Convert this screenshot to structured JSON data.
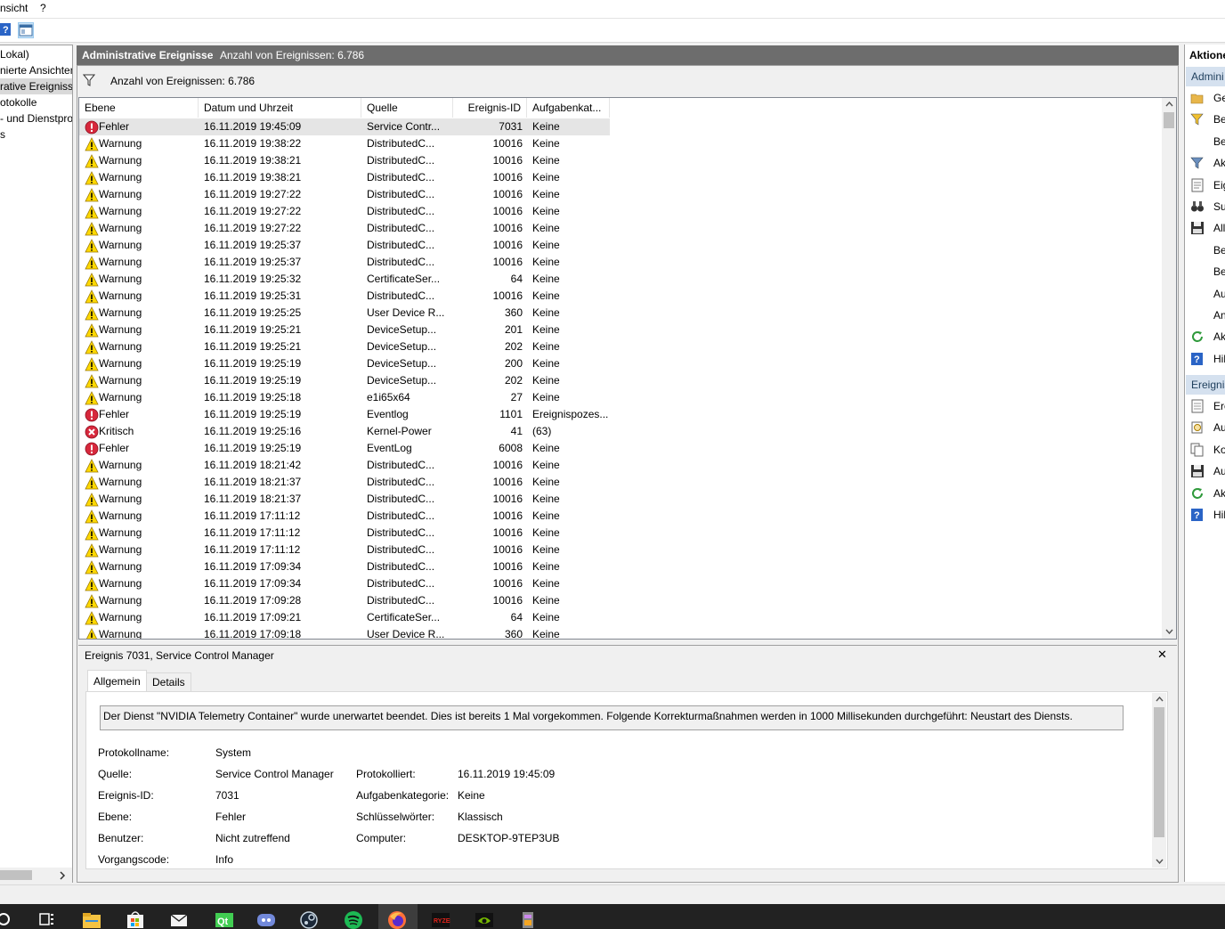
{
  "menu": {
    "items": [
      "nsicht",
      "?"
    ]
  },
  "tree": {
    "items": [
      {
        "label": "Lokal)"
      },
      {
        "label": "nierte Ansichten"
      },
      {
        "label": "rative Ereignisse",
        "selected": true
      },
      {
        "label": "otokolle"
      },
      {
        "label": "- und Dienstprot"
      },
      {
        "label": "s"
      }
    ]
  },
  "header": {
    "title": "Administrative Ereignisse",
    "count": "Anzahl von Ereignissen: 6.786"
  },
  "filter": {
    "label": "Anzahl von Ereignissen: 6.786"
  },
  "grid": {
    "columns": [
      "Ebene",
      "Datum und Uhrzeit",
      "Quelle",
      "Ereignis-ID",
      "Aufgabenkat..."
    ],
    "rows": [
      {
        "level": "Fehler",
        "type": "error",
        "dt": "16.11.2019 19:45:09",
        "src": "Service Contr...",
        "id": "7031",
        "task": "Keine",
        "selected": true
      },
      {
        "level": "Warnung",
        "type": "warn",
        "dt": "16.11.2019 19:38:22",
        "src": "DistributedC...",
        "id": "10016",
        "task": "Keine"
      },
      {
        "level": "Warnung",
        "type": "warn",
        "dt": "16.11.2019 19:38:21",
        "src": "DistributedC...",
        "id": "10016",
        "task": "Keine"
      },
      {
        "level": "Warnung",
        "type": "warn",
        "dt": "16.11.2019 19:38:21",
        "src": "DistributedC...",
        "id": "10016",
        "task": "Keine"
      },
      {
        "level": "Warnung",
        "type": "warn",
        "dt": "16.11.2019 19:27:22",
        "src": "DistributedC...",
        "id": "10016",
        "task": "Keine"
      },
      {
        "level": "Warnung",
        "type": "warn",
        "dt": "16.11.2019 19:27:22",
        "src": "DistributedC...",
        "id": "10016",
        "task": "Keine"
      },
      {
        "level": "Warnung",
        "type": "warn",
        "dt": "16.11.2019 19:27:22",
        "src": "DistributedC...",
        "id": "10016",
        "task": "Keine"
      },
      {
        "level": "Warnung",
        "type": "warn",
        "dt": "16.11.2019 19:25:37",
        "src": "DistributedC...",
        "id": "10016",
        "task": "Keine"
      },
      {
        "level": "Warnung",
        "type": "warn",
        "dt": "16.11.2019 19:25:37",
        "src": "DistributedC...",
        "id": "10016",
        "task": "Keine"
      },
      {
        "level": "Warnung",
        "type": "warn",
        "dt": "16.11.2019 19:25:32",
        "src": "CertificateSer...",
        "id": "64",
        "task": "Keine"
      },
      {
        "level": "Warnung",
        "type": "warn",
        "dt": "16.11.2019 19:25:31",
        "src": "DistributedC...",
        "id": "10016",
        "task": "Keine"
      },
      {
        "level": "Warnung",
        "type": "warn",
        "dt": "16.11.2019 19:25:25",
        "src": "User Device R...",
        "id": "360",
        "task": "Keine"
      },
      {
        "level": "Warnung",
        "type": "warn",
        "dt": "16.11.2019 19:25:21",
        "src": "DeviceSetup...",
        "id": "201",
        "task": "Keine"
      },
      {
        "level": "Warnung",
        "type": "warn",
        "dt": "16.11.2019 19:25:21",
        "src": "DeviceSetup...",
        "id": "202",
        "task": "Keine"
      },
      {
        "level": "Warnung",
        "type": "warn",
        "dt": "16.11.2019 19:25:19",
        "src": "DeviceSetup...",
        "id": "200",
        "task": "Keine"
      },
      {
        "level": "Warnung",
        "type": "warn",
        "dt": "16.11.2019 19:25:19",
        "src": "DeviceSetup...",
        "id": "202",
        "task": "Keine"
      },
      {
        "level": "Warnung",
        "type": "warn",
        "dt": "16.11.2019 19:25:18",
        "src": "e1i65x64",
        "id": "27",
        "task": "Keine"
      },
      {
        "level": "Fehler",
        "type": "error",
        "dt": "16.11.2019 19:25:19",
        "src": "Eventlog",
        "id": "1101",
        "task": "Ereignispozes..."
      },
      {
        "level": "Kritisch",
        "type": "critical",
        "dt": "16.11.2019 19:25:16",
        "src": "Kernel-Power",
        "id": "41",
        "task": "(63)"
      },
      {
        "level": "Fehler",
        "type": "error",
        "dt": "16.11.2019 19:25:19",
        "src": "EventLog",
        "id": "6008",
        "task": "Keine"
      },
      {
        "level": "Warnung",
        "type": "warn",
        "dt": "16.11.2019 18:21:42",
        "src": "DistributedC...",
        "id": "10016",
        "task": "Keine"
      },
      {
        "level": "Warnung",
        "type": "warn",
        "dt": "16.11.2019 18:21:37",
        "src": "DistributedC...",
        "id": "10016",
        "task": "Keine"
      },
      {
        "level": "Warnung",
        "type": "warn",
        "dt": "16.11.2019 18:21:37",
        "src": "DistributedC...",
        "id": "10016",
        "task": "Keine"
      },
      {
        "level": "Warnung",
        "type": "warn",
        "dt": "16.11.2019 17:11:12",
        "src": "DistributedC...",
        "id": "10016",
        "task": "Keine"
      },
      {
        "level": "Warnung",
        "type": "warn",
        "dt": "16.11.2019 17:11:12",
        "src": "DistributedC...",
        "id": "10016",
        "task": "Keine"
      },
      {
        "level": "Warnung",
        "type": "warn",
        "dt": "16.11.2019 17:11:12",
        "src": "DistributedC...",
        "id": "10016",
        "task": "Keine"
      },
      {
        "level": "Warnung",
        "type": "warn",
        "dt": "16.11.2019 17:09:34",
        "src": "DistributedC...",
        "id": "10016",
        "task": "Keine"
      },
      {
        "level": "Warnung",
        "type": "warn",
        "dt": "16.11.2019 17:09:34",
        "src": "DistributedC...",
        "id": "10016",
        "task": "Keine"
      },
      {
        "level": "Warnung",
        "type": "warn",
        "dt": "16.11.2019 17:09:28",
        "src": "DistributedC...",
        "id": "10016",
        "task": "Keine"
      },
      {
        "level": "Warnung",
        "type": "warn",
        "dt": "16.11.2019 17:09:21",
        "src": "CertificateSer...",
        "id": "64",
        "task": "Keine"
      },
      {
        "level": "Warnung",
        "type": "warn",
        "dt": "16.11.2019 17:09:18",
        "src": "User Device R...",
        "id": "360",
        "task": "Keine"
      }
    ]
  },
  "detail": {
    "title": "Ereignis 7031, Service Control Manager",
    "close": "✕",
    "tabs": [
      "Allgemein",
      "Details"
    ],
    "message": "Der Dienst \"NVIDIA Telemetry Container\" wurde unerwartet beendet. Dies ist bereits 1 Mal vorgekommen. Folgende Korrekturmaßnahmen werden in 1000 Millisekunden durchgeführt: Neustart des Diensts.",
    "fields": {
      "protokollname_label": "Protokollname:",
      "protokollname": "System",
      "quelle_label": "Quelle:",
      "quelle": "Service Control Manager",
      "protokolliert_label": "Protokolliert:",
      "protokolliert": "16.11.2019 19:45:09",
      "id_label": "Ereignis-ID:",
      "id": "7031",
      "aufgabe_label": "Aufgabenkategorie:",
      "aufgabe": "Keine",
      "ebene_label": "Ebene:",
      "ebene": "Fehler",
      "schluessel_label": "Schlüsselwörter:",
      "schluessel": "Klassisch",
      "benutzer_label": "Benutzer:",
      "benutzer": "Nicht zutreffend",
      "computer_label": "Computer:",
      "computer": "DESKTOP-9TEP3UB",
      "vorgang_label": "Vorgangscode:",
      "vorgang": "Info"
    }
  },
  "actions": {
    "title": "Aktione",
    "section1": "Admini",
    "items1": [
      {
        "label": "Ge",
        "icon": "folder-open-icon"
      },
      {
        "label": "Be",
        "icon": "filter-edit-icon"
      },
      {
        "label": "Be",
        "icon": ""
      },
      {
        "label": "Ak",
        "icon": "filter-icon"
      },
      {
        "label": "Eig",
        "icon": "properties-icon"
      },
      {
        "label": "Su",
        "icon": "binoculars-icon"
      },
      {
        "label": "All",
        "icon": "save-icon"
      },
      {
        "label": "Be",
        "icon": ""
      },
      {
        "label": "Be",
        "icon": ""
      },
      {
        "label": "Au",
        "icon": ""
      },
      {
        "label": "An",
        "icon": ""
      },
      {
        "label": "Ak",
        "icon": "refresh-icon"
      },
      {
        "label": "Hil",
        "icon": "help-icon"
      }
    ],
    "section2": "Ereignis",
    "items2": [
      {
        "label": "Ere",
        "icon": "event-properties-icon"
      },
      {
        "label": "Au",
        "icon": "attach-task-icon"
      },
      {
        "label": "Ko",
        "icon": "copy-icon"
      },
      {
        "label": "Au",
        "icon": "save-icon"
      },
      {
        "label": "Ak",
        "icon": "refresh-icon"
      },
      {
        "label": "Hil",
        "icon": "help-icon"
      }
    ]
  },
  "taskbar": {
    "icons": [
      "search-circle-icon",
      "task-view-icon",
      "file-explorer-icon",
      "store-icon",
      "mail-icon",
      "qt-icon",
      "discord-icon",
      "steam-icon",
      "spotify-icon",
      "firefox-icon",
      "ryzen-master-icon",
      "nvidia-icon",
      "app-icon"
    ]
  }
}
